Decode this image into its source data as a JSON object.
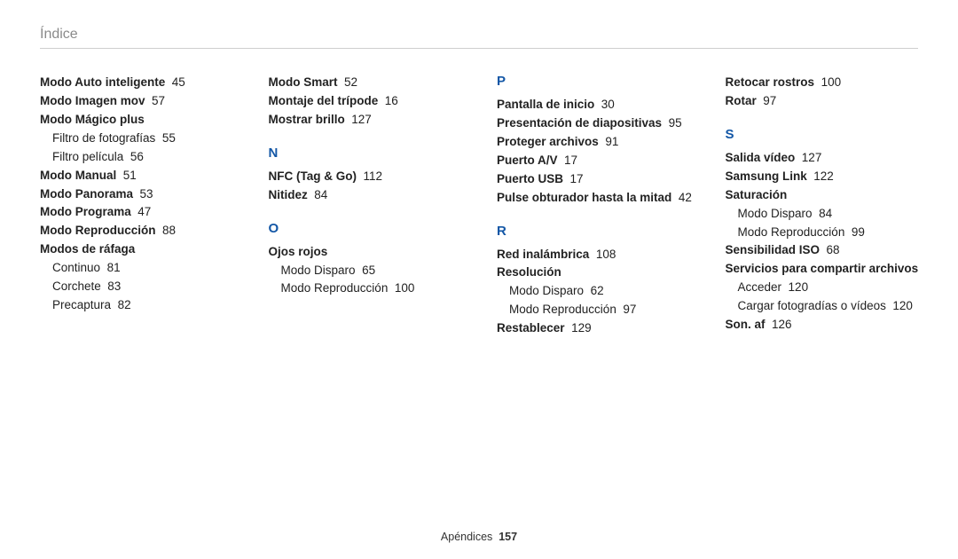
{
  "header": "Índice",
  "footer": {
    "section": "Apéndices",
    "page": "157"
  },
  "columns": [
    [
      {
        "type": "entry",
        "label": "Modo Auto inteligente",
        "page": "45"
      },
      {
        "type": "entry",
        "label": "Modo Imagen mov",
        "page": "57"
      },
      {
        "type": "entry",
        "label": "Modo Mágico plus"
      },
      {
        "type": "sub",
        "label": "Filtro de fotografías",
        "page": "55"
      },
      {
        "type": "sub",
        "label": "Filtro película",
        "page": "56"
      },
      {
        "type": "entry",
        "label": "Modo Manual",
        "page": "51"
      },
      {
        "type": "entry",
        "label": "Modo Panorama",
        "page": "53"
      },
      {
        "type": "entry",
        "label": "Modo Programa",
        "page": "47"
      },
      {
        "type": "entry",
        "label": "Modo Reproducción",
        "page": "88"
      },
      {
        "type": "entry",
        "label": "Modos de ráfaga"
      },
      {
        "type": "sub",
        "label": "Continuo",
        "page": "81"
      },
      {
        "type": "sub",
        "label": "Corchete",
        "page": "83"
      },
      {
        "type": "sub",
        "label": "Precaptura",
        "page": "82"
      }
    ],
    [
      {
        "type": "entry",
        "label": "Modo Smart",
        "page": "52"
      },
      {
        "type": "entry",
        "label": "Montaje del trípode",
        "page": "16"
      },
      {
        "type": "entry",
        "label": "Mostrar brillo",
        "page": "127"
      },
      {
        "type": "letter",
        "text": "N"
      },
      {
        "type": "entry",
        "label": "NFC (Tag & Go)",
        "page": "112"
      },
      {
        "type": "entry",
        "label": "Nitidez",
        "page": "84"
      },
      {
        "type": "letter",
        "text": "O"
      },
      {
        "type": "entry",
        "label": "Ojos rojos"
      },
      {
        "type": "sub",
        "label": "Modo Disparo",
        "page": "65"
      },
      {
        "type": "sub",
        "label": "Modo Reproducción",
        "page": "100"
      }
    ],
    [
      {
        "type": "letter",
        "text": "P"
      },
      {
        "type": "entry",
        "label": "Pantalla de inicio",
        "page": "30"
      },
      {
        "type": "entry",
        "label": "Presentación de diapositivas",
        "page": "95"
      },
      {
        "type": "entry",
        "label": "Proteger archivos",
        "page": "91"
      },
      {
        "type": "entry",
        "label": "Puerto A/V",
        "page": "17"
      },
      {
        "type": "entry",
        "label": "Puerto USB",
        "page": "17"
      },
      {
        "type": "entry",
        "label": "Pulse obturador hasta la mitad",
        "page": "42"
      },
      {
        "type": "letter",
        "text": "R"
      },
      {
        "type": "entry",
        "label": "Red inalámbrica",
        "page": "108"
      },
      {
        "type": "entry",
        "label": "Resolución"
      },
      {
        "type": "sub",
        "label": "Modo Disparo",
        "page": "62"
      },
      {
        "type": "sub",
        "label": "Modo Reproducción",
        "page": "97"
      },
      {
        "type": "entry",
        "label": "Restablecer",
        "page": "129"
      }
    ],
    [
      {
        "type": "entry",
        "label": "Retocar rostros",
        "page": "100"
      },
      {
        "type": "entry",
        "label": "Rotar",
        "page": "97"
      },
      {
        "type": "letter",
        "text": "S"
      },
      {
        "type": "entry",
        "label": "Salida vídeo",
        "page": "127"
      },
      {
        "type": "entry",
        "label": "Samsung Link",
        "page": "122"
      },
      {
        "type": "entry",
        "label": "Saturación"
      },
      {
        "type": "sub",
        "label": "Modo Disparo",
        "page": "84"
      },
      {
        "type": "sub",
        "label": "Modo Reproducción",
        "page": "99"
      },
      {
        "type": "entry",
        "label": "Sensibilidad ISO",
        "page": "68"
      },
      {
        "type": "entry",
        "label": "Servicios para compartir archivos"
      },
      {
        "type": "sub",
        "label": "Acceder",
        "page": "120"
      },
      {
        "type": "sub",
        "label": "Cargar fotogradías o vídeos",
        "page": "120"
      },
      {
        "type": "entry",
        "label": "Son. af",
        "page": "126"
      }
    ]
  ]
}
